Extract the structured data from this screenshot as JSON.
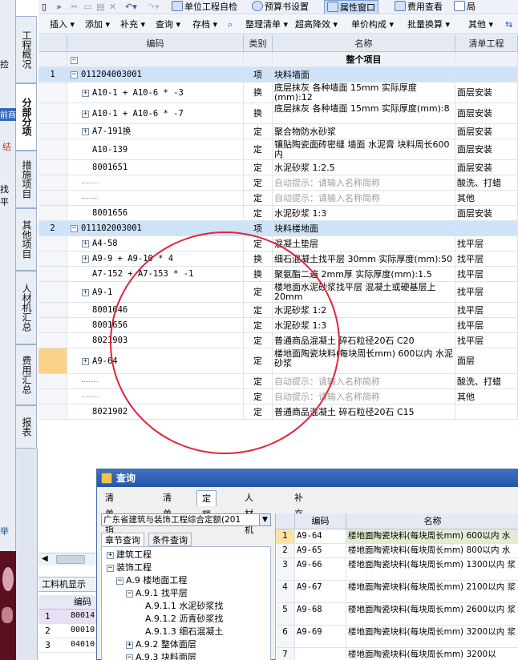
{
  "toolbar_top": {
    "unit_check": "单位工程自检",
    "budget_settings": "预算书设置",
    "property_window": "属性窗口",
    "cost_view": "费用查看",
    "layout_fragment": "局"
  },
  "toolbar_main": {
    "insert": "插入",
    "add": "添加",
    "supplement": "补充",
    "query": "查询",
    "store": "存档",
    "arrange_list": "整理清单",
    "height_drop": "超高降效",
    "unit_price_comp": "单价构成",
    "batch_replace": "批量换算",
    "other": "其他"
  },
  "left_edge_fragments": [
    "捡",
    "前商",
    "结",
    "找平",
    "举"
  ],
  "side_tabs": [
    {
      "label": "工程概况"
    },
    {
      "label": "分部分项"
    },
    {
      "label": "措施项目"
    },
    {
      "label": "其他项目"
    },
    {
      "label": "人材机汇总"
    },
    {
      "label": "费用汇总"
    },
    {
      "label": "报表"
    }
  ],
  "grid": {
    "headers": {
      "code": "编码",
      "type": "类别",
      "name": "名称",
      "list_work": "清单工程"
    },
    "top_row": {
      "toggle": "−",
      "name": "整个项目"
    },
    "rows": [
      {
        "num": "1",
        "code": "011204003001",
        "type": "项",
        "name": "块料墙面",
        "work": "",
        "blue": true,
        "toggle": "−"
      },
      {
        "num": "",
        "code": "A10-1 + A10-6 * -3",
        "type": "换",
        "name": "底层抹灰 各种墙面 15mm 实际厚度(mm):12",
        "work": "面层安装",
        "toggle": "+"
      },
      {
        "num": "",
        "code": "A10-1 + A10-6 * -7",
        "type": "换",
        "name": "底层抹灰 各种墙面 15mm 实际厚度(mm):8",
        "work": "面层安装",
        "toggle": "+"
      },
      {
        "num": "",
        "code": "A7-191换",
        "type": "定",
        "name": "聚合物防水砂浆",
        "work": "面层安装",
        "toggle": "+"
      },
      {
        "num": "",
        "code": "A10-139",
        "type": "定",
        "name": "镶贴陶瓷面砖密缝 墙面 水泥膏 块料周长600内",
        "work": "面层安装"
      },
      {
        "num": "",
        "code": "8001651",
        "type": "定",
        "name": "水泥砂浆 1:2.5",
        "work": "面层安装"
      },
      {
        "num": "",
        "code": "",
        "type": "定",
        "name": "自动提示：请输入名称简称",
        "work": "酸洗、打蜡",
        "hint": true
      },
      {
        "num": "",
        "code": "",
        "type": "定",
        "name": "自动提示：请输入名称简称",
        "work": "其他",
        "hint": true
      },
      {
        "num": "",
        "code": "8001656",
        "type": "定",
        "name": "水泥砂浆 1:3",
        "work": "面层安装"
      },
      {
        "num": "2",
        "code": "011102003001",
        "type": "项",
        "name": "块料楼地面",
        "work": "",
        "blue": true,
        "toggle": "−"
      },
      {
        "num": "",
        "code": "A4-58",
        "type": "定",
        "name": "混凝土垫层",
        "work": "找平层",
        "toggle": "+"
      },
      {
        "num": "",
        "code": "A9-9 + A9-10 * 4",
        "type": "换",
        "name": "细石混凝土找平层 30mm 实际厚度(mm):50",
        "work": "找平层",
        "toggle": "+"
      },
      {
        "num": "",
        "code": "A7-152 + A7-153 * -1",
        "type": "换",
        "name": "聚氨酯二遍 2mm厚 实际厚度(mm):1.5",
        "work": "找平层"
      },
      {
        "num": "",
        "code": "A9-1",
        "type": "定",
        "name": "楼地面水泥砂浆找平层 混凝土或硬基层上 20mm",
        "work": "找平层",
        "toggle": "+"
      },
      {
        "num": "",
        "code": "8001646",
        "type": "定",
        "name": "水泥砂浆 1:2",
        "work": "找平层"
      },
      {
        "num": "",
        "code": "8001656",
        "type": "定",
        "name": "水泥砂浆 1:3",
        "work": "找平层"
      },
      {
        "num": "",
        "code": "8021903",
        "type": "定",
        "name": "普通商品混凝土 碎石粒径20石 C20",
        "work": "找平层"
      },
      {
        "num": "",
        "code": "A9-64",
        "type": "定",
        "name": "楼地面陶瓷块料(每块周长mm) 600以内 水泥砂浆",
        "work": "面层",
        "toggle": "+",
        "orange": true
      },
      {
        "num": "",
        "code": "",
        "type": "定",
        "name": "自动提示：请输入名称简称",
        "work": "酸洗、打蜡",
        "hint": true
      },
      {
        "num": "",
        "code": "",
        "type": "定",
        "name": "自动提示：请输入名称简称",
        "work": "其他",
        "hint": true
      },
      {
        "num": "",
        "code": "8021902",
        "type": "定",
        "name": "普通商品混凝土 碎石粒径20石 C15",
        "work": ""
      }
    ]
  },
  "bottom_panel": {
    "title": "工料机显示",
    "header_code": "编码",
    "rows": [
      {
        "num": "1",
        "code": "80014"
      },
      {
        "num": "2",
        "code": "00010"
      },
      {
        "num": "3",
        "code": "04010"
      }
    ]
  },
  "dialog": {
    "title": "查询",
    "tabs": [
      "清单指引",
      "清单",
      "定额",
      "人材机",
      "补充人材机"
    ],
    "selected_tab": "定额",
    "library": "广东省建筑与装饰工程综合定额(201",
    "subtabs": [
      "章节查询",
      "条件查询"
    ],
    "tree": [
      {
        "toggle": "+",
        "label": "建筑工程",
        "level": 0
      },
      {
        "toggle": "−",
        "label": "装饰工程",
        "level": 0
      },
      {
        "toggle": "−",
        "label": "A.9 楼地面工程",
        "level": 1
      },
      {
        "toggle": "−",
        "label": "A.9.1 找平层",
        "level": 2
      },
      {
        "toggle": "",
        "label": "A.9.1.1 水泥砂浆找",
        "level": 3
      },
      {
        "toggle": "",
        "label": "A.9.1.2 沥青砂浆找",
        "level": 3
      },
      {
        "toggle": "",
        "label": "A.9.1.3 细石混凝土",
        "level": 3
      },
      {
        "toggle": "+",
        "label": "A.9.2 整体面层",
        "level": 2
      },
      {
        "toggle": "−",
        "label": "A.9.3 块料面层",
        "level": 2
      }
    ],
    "result_headers": {
      "code": "编码",
      "name": "名称"
    },
    "results": [
      {
        "num": "1",
        "code": "A9-64",
        "name": "楼地面陶瓷块料(每块周长mm) 600以内 水"
      },
      {
        "num": "2",
        "code": "A9-65",
        "name": "楼地面陶瓷块料(每块周长mm) 800以内 水"
      },
      {
        "num": "3",
        "code": "A9-66",
        "name": "楼地面陶瓷块料(每块周长mm) 1300以内 浆"
      },
      {
        "num": "4",
        "code": "A9-67",
        "name": "楼地面陶瓷块料(每块周长mm) 2100以内 浆"
      },
      {
        "num": "5",
        "code": "A9-68",
        "name": "楼地面陶瓷块料(每块周长mm) 2600以内 浆"
      },
      {
        "num": "6",
        "code": "A9-69",
        "name": "楼地面陶瓷块料(每块周长mm) 3200以内 浆"
      },
      {
        "num": "7",
        "code": "",
        "name": "楼地面陶瓷块料(每块周长mm) 3200以"
      }
    ]
  },
  "colors": {
    "selection_blue": "#cfe3f8",
    "row_orange": "#fbd28a",
    "annotation_red": "#e0263a",
    "title_blue": "#2556a8"
  }
}
